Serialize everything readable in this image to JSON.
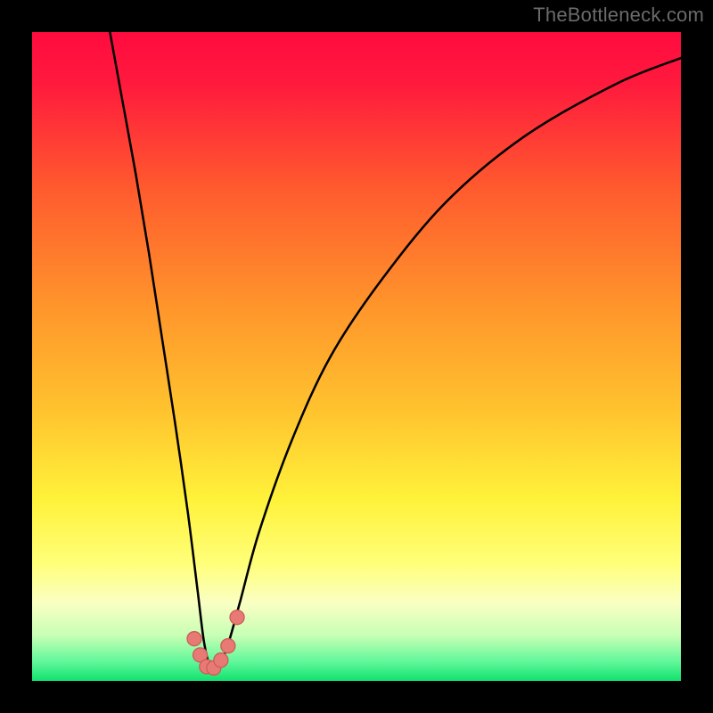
{
  "watermark": "TheBottleneck.com",
  "colors": {
    "black": "#000000",
    "watermark_text": "#6b6b6b",
    "curve_stroke": "#000000",
    "marker_fill": "#e77a74",
    "marker_stroke": "#cf5c56"
  },
  "chart_data": {
    "type": "line",
    "title": "",
    "xlabel": "",
    "ylabel": "",
    "xlim": [
      0,
      100
    ],
    "ylim": [
      0,
      100
    ],
    "grid": false,
    "legend": false,
    "background_gradient_stops": [
      {
        "pct": 0,
        "color": "#ff0b3f"
      },
      {
        "pct": 8,
        "color": "#ff1a3d"
      },
      {
        "pct": 24,
        "color": "#ff5a2e"
      },
      {
        "pct": 42,
        "color": "#ff942b"
      },
      {
        "pct": 58,
        "color": "#ffc22e"
      },
      {
        "pct": 72,
        "color": "#fff23a"
      },
      {
        "pct": 82,
        "color": "#ffff7a"
      },
      {
        "pct": 88,
        "color": "#faffc3"
      },
      {
        "pct": 93,
        "color": "#c7ffb5"
      },
      {
        "pct": 97,
        "color": "#62f79a"
      },
      {
        "pct": 100,
        "color": "#11e26f"
      }
    ],
    "series": [
      {
        "name": "bottleneck-curve",
        "x": [
          12,
          14,
          16,
          18,
          20,
          22,
          24,
          25.5,
          26.5,
          27.5,
          28.5,
          30,
          32,
          35,
          40,
          46,
          54,
          64,
          76,
          90,
          100
        ],
        "y": [
          100,
          89,
          78,
          66,
          53,
          40,
          26,
          14,
          6,
          2,
          2,
          5,
          12,
          23,
          37,
          50,
          62,
          74,
          84,
          92,
          96
        ]
      }
    ],
    "markers": [
      {
        "x": 25.0,
        "y": 6.5,
        "r": 1.1
      },
      {
        "x": 25.9,
        "y": 4.0,
        "r": 1.1
      },
      {
        "x": 26.9,
        "y": 2.2,
        "r": 1.1
      },
      {
        "x": 28.0,
        "y": 2.0,
        "r": 1.1
      },
      {
        "x": 29.1,
        "y": 3.2,
        "r": 1.1
      },
      {
        "x": 30.2,
        "y": 5.4,
        "r": 1.1
      },
      {
        "x": 31.6,
        "y": 9.8,
        "r": 1.1
      }
    ]
  }
}
